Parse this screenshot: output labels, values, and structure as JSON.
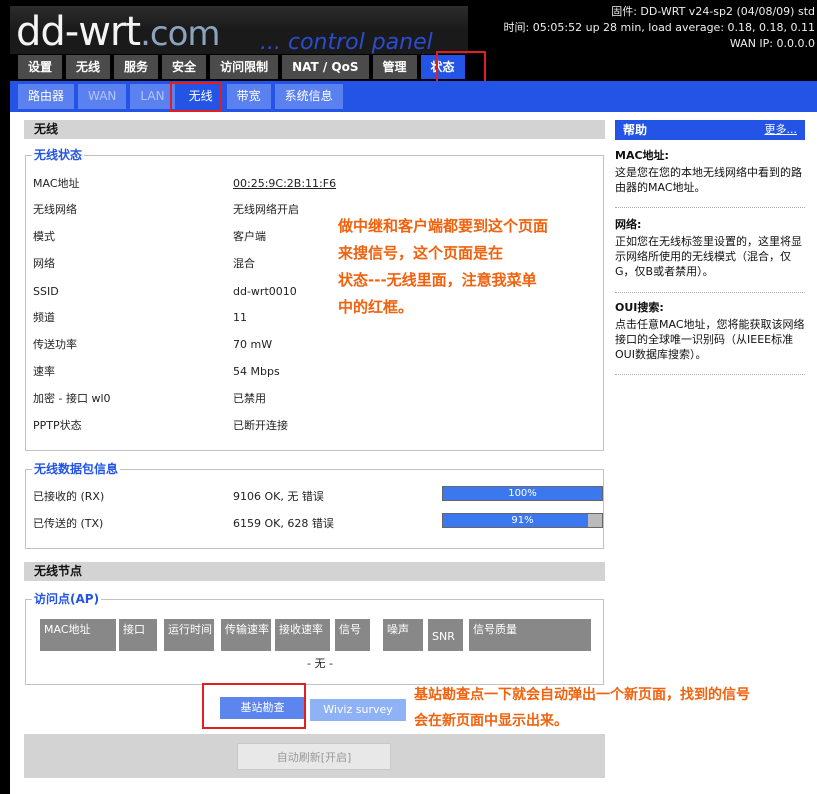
{
  "header": {
    "logo": "dd-wrt",
    "logo_suffix": ".com",
    "tagline": "... control panel",
    "firmware": "固件: DD-WRT v24-sp2 (04/08/09) std",
    "time": "时间: 05:05:52 up 28 min, load average: 0.18, 0.18, 0.11",
    "wan_ip": "WAN IP: 0.0.0.0"
  },
  "main_tabs": [
    {
      "label": "设置"
    },
    {
      "label": "无线"
    },
    {
      "label": "服务"
    },
    {
      "label": "安全"
    },
    {
      "label": "访问限制"
    },
    {
      "label": "NAT / QoS"
    },
    {
      "label": "管理"
    },
    {
      "label": "状态",
      "active": true
    }
  ],
  "sub_tabs": [
    {
      "label": "路由器"
    },
    {
      "label": "WAN"
    },
    {
      "label": "LAN"
    },
    {
      "label": "无线",
      "active": true
    },
    {
      "label": "带宽"
    },
    {
      "label": "系统信息"
    }
  ],
  "wireless": {
    "section_title": "无线",
    "status_legend": "无线状态",
    "rows": [
      {
        "label": "MAC地址",
        "value": "00:25:9C:2B:11:F6"
      },
      {
        "label": "无线网络",
        "value": "无线网络开启"
      },
      {
        "label": "模式",
        "value": "客户端"
      },
      {
        "label": "网络",
        "value": "混合"
      },
      {
        "label": "SSID",
        "value": "dd-wrt0010"
      },
      {
        "label": "频道",
        "value": "11"
      },
      {
        "label": "传送功率",
        "value": "70 mW"
      },
      {
        "label": "速率",
        "value": "54 Mbps"
      },
      {
        "label": "加密 - 接口 wl0",
        "value": "已禁用"
      },
      {
        "label": "PPTP状态",
        "value": "已断开连接"
      }
    ]
  },
  "packets": {
    "legend": "无线数据包信息",
    "rows": [
      {
        "label": "已接收的 (RX)",
        "value": "9106 OK, 无 错误",
        "bar_label": "100%",
        "fraction": 1.0
      },
      {
        "label": "已传送的 (TX)",
        "value": "6159 OK, 628 错误",
        "bar_label": "91%",
        "fraction": 0.91
      }
    ]
  },
  "nodes": {
    "section_title": "无线节点",
    "ap_legend": "访问点(AP)",
    "columns": [
      "MAC地址",
      "接口",
      "运行时间",
      "传输速率",
      "接收速率",
      "信号",
      "噪声",
      "SNR",
      "信号质量"
    ],
    "empty_text": "- 无 -"
  },
  "buttons": {
    "site_survey": "基站勘查",
    "wiviz": "Wiviz survey",
    "auto_refresh": "自动刷新[开启]"
  },
  "help": {
    "title": "帮助",
    "more": "更多...",
    "items": [
      {
        "title": "MAC地址:",
        "text": "这是您在您的本地无线网络中看到的路由器的MAC地址。"
      },
      {
        "title": "网络:",
        "text": "正如您在无线标签里设置的，这里将显示网络所使用的无线模式（混合，仅G，仅B或者禁用）。"
      },
      {
        "title": "OUI搜索:",
        "text": "点击任意MAC地址，您将能获取该网络接口的全球唯一识别码（从IEEE标准OUI数据库搜索）。"
      }
    ]
  },
  "notes": {
    "middle": [
      "做中继和客户端都要到这个页面",
      "来搜信号，这个页面是在",
      "状态---无线里面，注意我菜单",
      "中的红框。"
    ],
    "bottom": [
      "基站勘查点一下就会自动弹出一个新页面，找到的信号",
      "会在新页面中显示出来。"
    ]
  },
  "colors": {
    "accent": "#2354e6",
    "annotation": "#f0620e",
    "highlight_box": "#e02020"
  }
}
